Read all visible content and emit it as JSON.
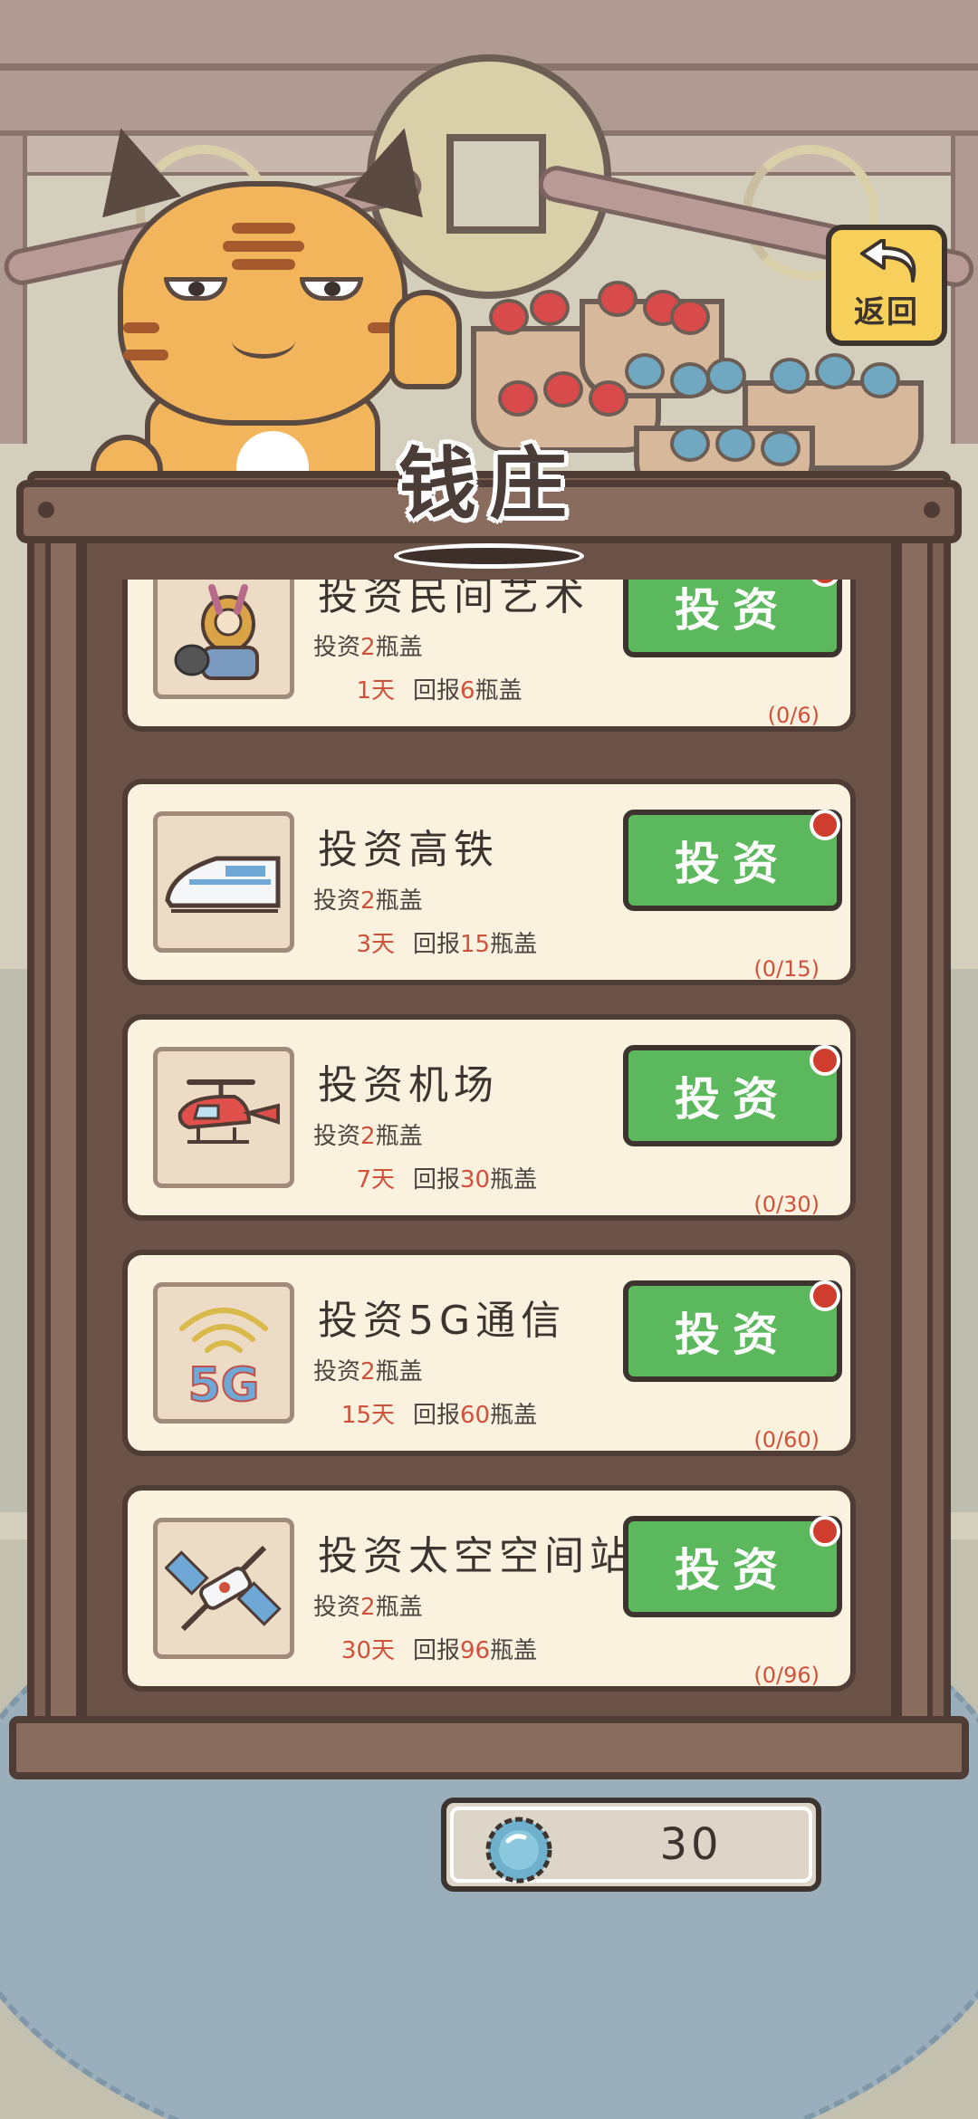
{
  "header": {
    "title": "钱庄",
    "back_label": "返回"
  },
  "investments": [
    {
      "title": "投资民间艺术",
      "cost_prefix": "投资",
      "cost_value": "2",
      "cost_unit": "瓶盖",
      "days": "1天",
      "reward_prefix": "回报",
      "reward_value": "6",
      "reward_unit": "瓶盖",
      "progress": "(0/6)",
      "button_label": "投资",
      "icon": "folk-art-icon"
    },
    {
      "title": "投资高铁",
      "cost_prefix": "投资",
      "cost_value": "2",
      "cost_unit": "瓶盖",
      "days": "3天",
      "reward_prefix": "回报",
      "reward_value": "15",
      "reward_unit": "瓶盖",
      "progress": "(0/15)",
      "button_label": "投资",
      "icon": "high-speed-train-icon"
    },
    {
      "title": "投资机场",
      "cost_prefix": "投资",
      "cost_value": "2",
      "cost_unit": "瓶盖",
      "days": "7天",
      "reward_prefix": "回报",
      "reward_value": "30",
      "reward_unit": "瓶盖",
      "progress": "(0/30)",
      "button_label": "投资",
      "icon": "helicopter-icon"
    },
    {
      "title": "投资5G通信",
      "cost_prefix": "投资",
      "cost_value": "2",
      "cost_unit": "瓶盖",
      "days": "15天",
      "reward_prefix": "回报",
      "reward_value": "60",
      "reward_unit": "瓶盖",
      "progress": "(0/60)",
      "button_label": "投资",
      "icon": "5g-signal-icon"
    },
    {
      "title": "投资太空空间站",
      "cost_prefix": "投资",
      "cost_value": "2",
      "cost_unit": "瓶盖",
      "days": "30天",
      "reward_prefix": "回报",
      "reward_value": "96",
      "reward_unit": "瓶盖",
      "progress": "(0/96)",
      "button_label": "投资",
      "icon": "space-station-icon"
    }
  ],
  "currency": {
    "value": "30",
    "icon": "bottle-cap-icon"
  },
  "colors": {
    "button_green": "#5cb85c",
    "badge_red": "#cf3d2e",
    "highlight_red": "#d0523c",
    "back_yellow": "#f7cf5b"
  }
}
